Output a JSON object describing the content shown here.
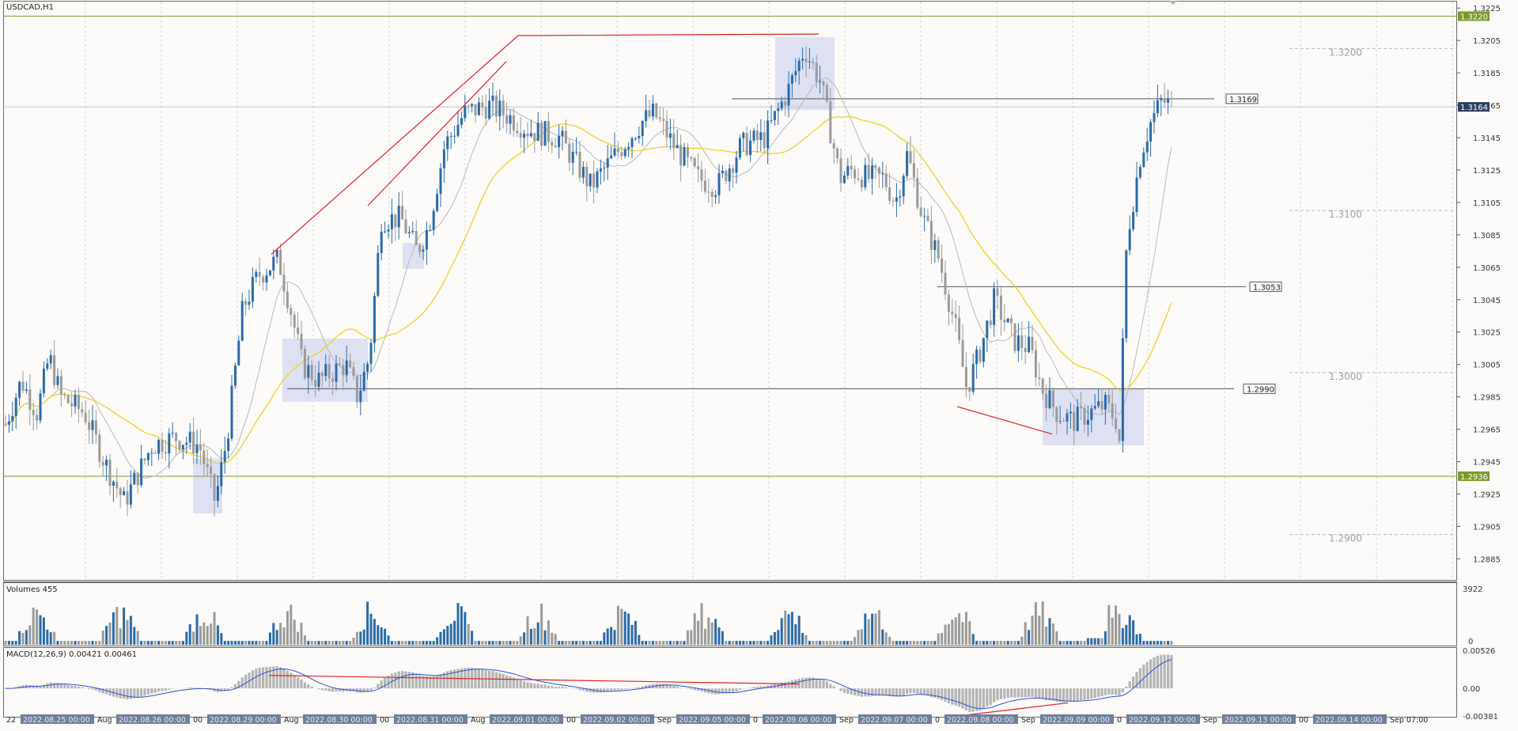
{
  "window": {
    "title": "USDCAD,H1"
  },
  "colors": {
    "background": "#fcfbf9",
    "bull": "#2a6aa8",
    "bear": "#9a9a9a",
    "ma_fast": "#b8b8b8",
    "ma_slow": "#f3cf2b",
    "zone": "#d7dcf2",
    "trendline": "#e02020",
    "hline": "#555555",
    "green_level": "#7a9a2a",
    "macd_signal": "#2a50d0",
    "macd_hist": "#b4b4b4"
  },
  "price_axis": {
    "min": 1.2872,
    "max": 1.3229,
    "labels": [
      "1.3225",
      "1.3205",
      "1.3185",
      "1.3165",
      "1.3145",
      "1.3125",
      "1.3105",
      "1.3085",
      "1.3065",
      "1.3045",
      "1.3025",
      "1.3005",
      "1.2985",
      "1.2965",
      "1.2945",
      "1.2925",
      "1.2905",
      "1.2885"
    ]
  },
  "levels": {
    "top_green": "1.3220",
    "bottom_green": "1.2936",
    "current": "1.3164",
    "boxes": [
      "1.3169",
      "1.3053",
      "1.2990"
    ],
    "round_numbers": [
      "1.3200",
      "1.3100",
      "1.3000",
      "1.2900"
    ]
  },
  "volume_pane": {
    "title": "Volumes 455",
    "scale_max": "3922",
    "scale_min": "0"
  },
  "macd_pane": {
    "title": "MACD(12,26,9) 0.00421 0.00461",
    "labels": [
      "0.00526",
      "0.00",
      "-0.00381"
    ]
  },
  "time_axis": {
    "labels": [
      "22",
      "2022.08.25 00:00",
      "Aug",
      "2022.08.26 00:00",
      "00",
      "2022.08.29 00:00",
      "Aug",
      "2022.08.30 00:00",
      "00",
      "2022.08.31 00:00",
      "Aug",
      "2022.09.01 00:00",
      "00",
      "2022.09.02 00:00",
      "Sep",
      "2022.09.05 00:00",
      "0",
      "2022.09.06 00:00",
      "Sep",
      "2022.09.07 00:00",
      "0",
      "2022.09.08 00:00",
      "Sep",
      "2022.09.09 00:00",
      "0",
      "2022.09.12 00:00",
      "Sep",
      "2022.09.13 00:00",
      "00",
      "2022.09.14 00:00",
      "Sep 07:00"
    ]
  }
}
